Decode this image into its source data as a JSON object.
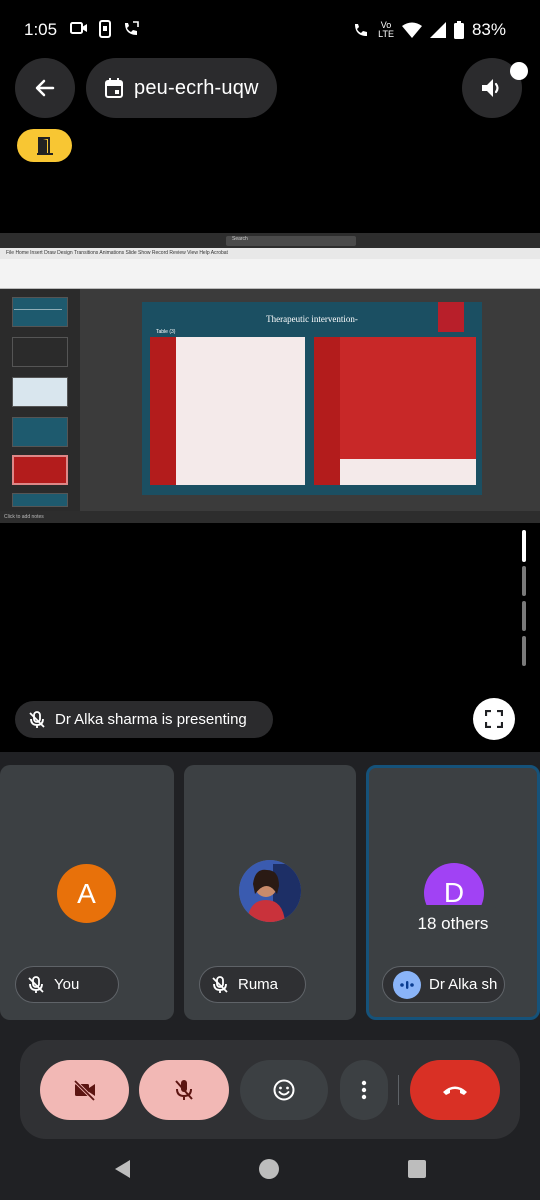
{
  "status_bar": {
    "time": "1:05",
    "network_top": "Vo",
    "network_sub": "LTE",
    "battery": "83%"
  },
  "header": {
    "meeting_code": "peu-ecrh-uqw"
  },
  "presentation": {
    "slide_title": "Therapeutic intervention-",
    "slide_subtitle": "Table (3)",
    "ppt_search": "Search",
    "ppt_menu": "File  Home  Insert  Draw  Design  Transitions  Animations  Slide Show  Record  Review  View  Help  Acrobat",
    "ppt_notes": "Click to add notes"
  },
  "presenting": {
    "text": "Dr Alka sharma is presenting"
  },
  "participants": [
    {
      "name": "You",
      "initial": "A",
      "color": "#e8710a"
    },
    {
      "name": "Ruma",
      "initial": "",
      "color": "#6b6b6b"
    },
    {
      "name": "Dr Alka sh",
      "initial": "D",
      "color": "#a142f4"
    }
  ],
  "others": {
    "label": "18 others"
  },
  "colors": {
    "leave_chip": "#f8c633",
    "end_call": "#d93025",
    "muted_button": "#f2b8b5",
    "tile": "#3c4043"
  }
}
